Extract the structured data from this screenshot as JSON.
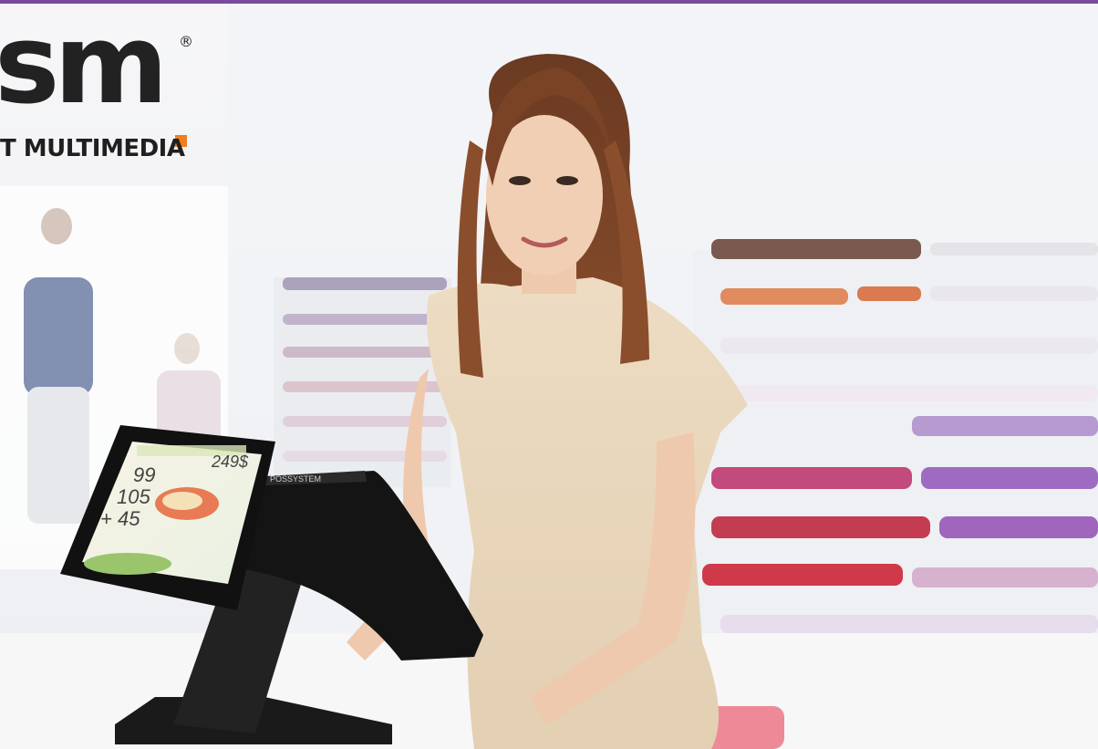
{
  "logo": {
    "wordmark": "sm",
    "registered_mark": "®",
    "tagline": "T MULTIMEDIA",
    "accent_color": "#f07d1e",
    "text_color": "#222222"
  },
  "pos_terminal": {
    "brand_label": "POSSYSTEM",
    "customer_display": {
      "price_label": "249$",
      "numbers": [
        "99",
        "105",
        "+ 45"
      ]
    }
  },
  "colors": {
    "top_bar": "#7a4a9e"
  }
}
